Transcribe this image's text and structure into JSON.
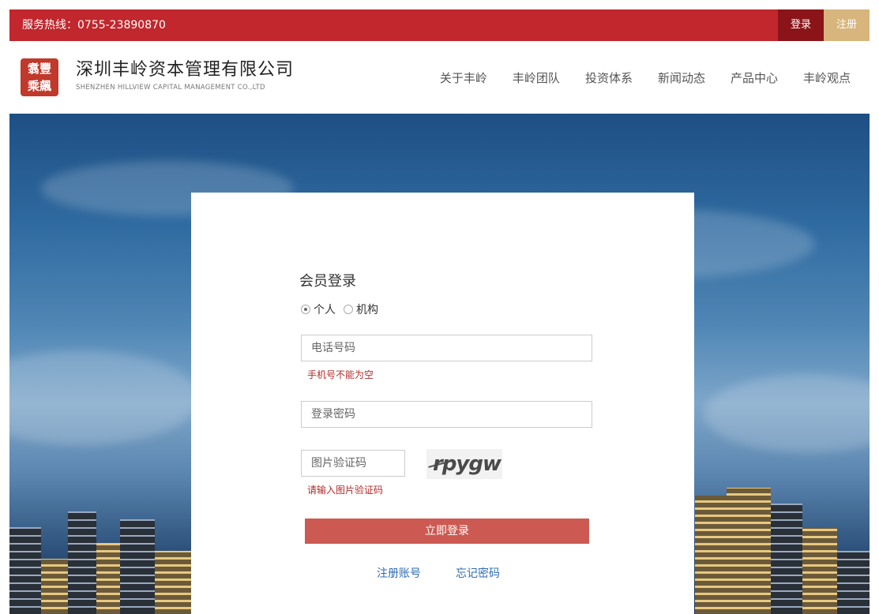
{
  "topbar": {
    "hotline": "服务热线：0755-23890870",
    "login_label": "登录",
    "register_label": "注册"
  },
  "header": {
    "logo_glyphs": "翥豐\n乘飆",
    "company_cn": "深圳丰岭资本管理有限公司",
    "company_en": "SHENZHEN HILLVIEW CAPITAL MANAGEMENT CO.,LTD",
    "nav": [
      "关于丰岭",
      "丰岭团队",
      "投资体系",
      "新闻动态",
      "产品中心",
      "丰岭观点"
    ]
  },
  "login": {
    "title": "会员登录",
    "radio_personal": "个人",
    "radio_institution": "机构",
    "phone_placeholder": "电话号码",
    "phone_error": "手机号不能为空",
    "password_placeholder": "登录密码",
    "captcha_placeholder": "图片验证码",
    "captcha_text": "rpygw",
    "captcha_error": "请输入图片验证码",
    "submit_label": "立即登录",
    "register_link": "注册账号",
    "forgot_link": "忘记密码"
  },
  "colors": {
    "brand_red": "#c1272d",
    "login_dark": "#8a1418",
    "register_gold": "#d7b57c",
    "submit": "#cc5a52",
    "link": "#2f6db3",
    "error": "#b52a2a"
  }
}
